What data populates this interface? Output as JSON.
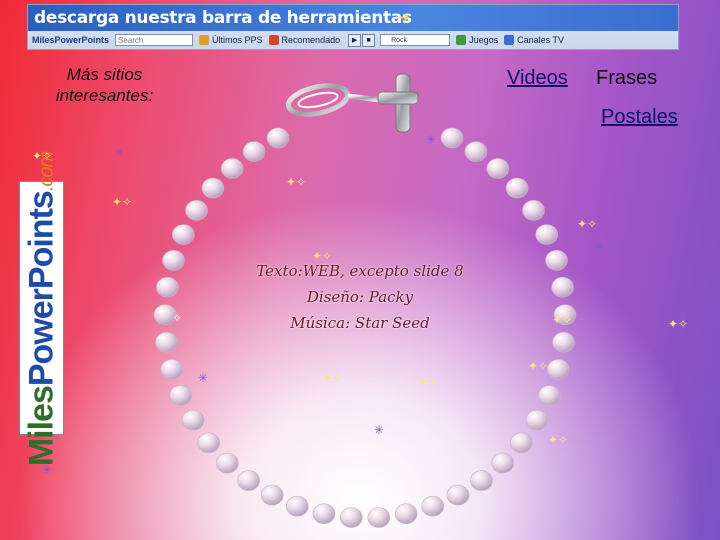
{
  "toolbar": {
    "title": "descarga nuestra barra de herramientas",
    "logo": "MilesPowerPoints",
    "search_placeholder": "Search",
    "ultimos": "Últimos PPS",
    "recomendado": "Recomendado",
    "radio": "Rock",
    "juegos": "Juegos",
    "canales": "Canales TV"
  },
  "side_heading": "Más sitios interesantes:",
  "links": {
    "videos": "Videos",
    "frases": "Frases",
    "postales": "Postales"
  },
  "logo": {
    "part1": "Miles",
    "part2": "PowerPoints",
    "suffix": ".com"
  },
  "credits": {
    "line1": "Texto:WEB, excepto slide 8",
    "line2": "Diseño: Packy",
    "line3": "Música: Star Seed"
  },
  "colors": {
    "pearl": "#ead7e6",
    "credits": "#6a1a2a",
    "link": "#10106a",
    "toolbar_blue": "#2a5fc0"
  }
}
